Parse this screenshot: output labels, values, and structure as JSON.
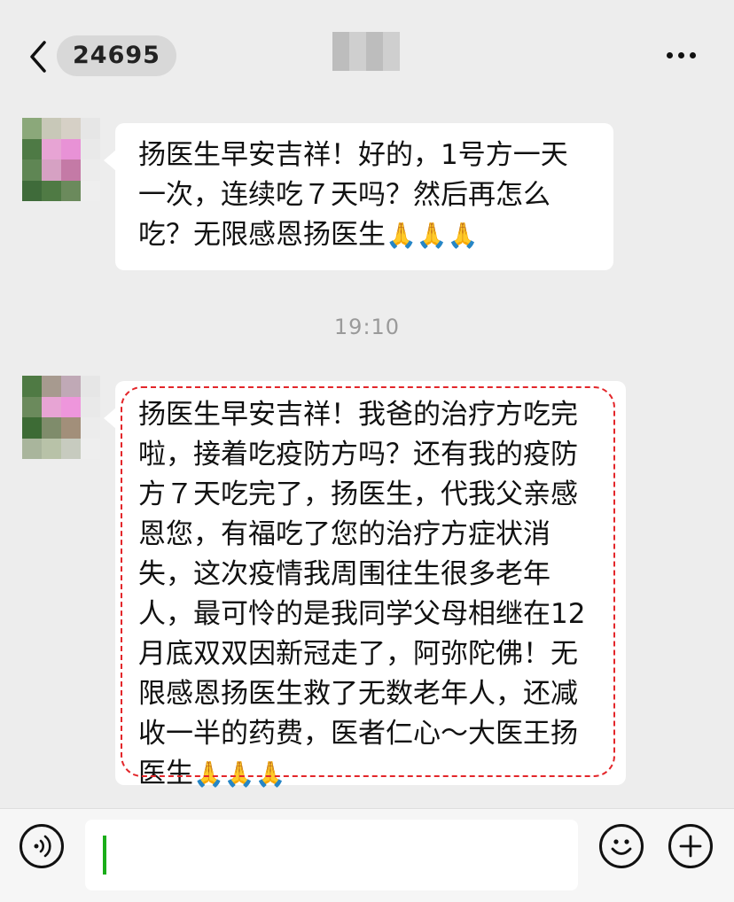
{
  "header": {
    "back_icon": "chevron-left-icon",
    "unread_count": "24695",
    "more_icon": "ellipsis-icon"
  },
  "messages": [
    {
      "text": "扬医生早安吉祥！好的，1号方一天一次，连续吃７天吗？然后再怎么吃？无限感恩扬医生",
      "emoji": "🙏🙏🙏"
    },
    {
      "text": "扬医生早安吉祥！我爸的治疗方吃完啦，接着吃疫防方吗？还有我的疫防方７天吃完了，扬医生，代我父亲感恩您，有福吃了您的治疗方症状消失，这次疫情我周围往生很多老年人，最可怜的是我同学父母相继在12月底双双因新冠走了，阿弥陀佛！无限感恩扬医生救了无数老年人，还减收一半的药费，医者仁心～大医王扬医生",
      "emoji": "🙏🙏🙏"
    }
  ],
  "timestamp": "19:10",
  "input_bar": {
    "voice_icon": "voice-icon",
    "emoji_icon": "smiley-icon",
    "plus_icon": "plus-icon",
    "text_value": ""
  },
  "colors": {
    "background": "#ededed",
    "bubble": "#ffffff",
    "highlight_border": "#e3262a",
    "caret": "#1aad19"
  }
}
